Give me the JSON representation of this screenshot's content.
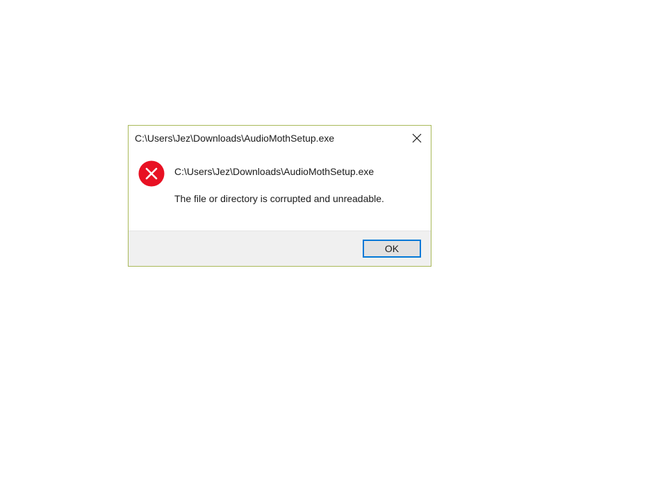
{
  "dialog": {
    "title": "C:\\Users\\Jez\\Downloads\\AudioMothSetup.exe",
    "close_icon": "close-icon",
    "error_icon": "error-icon",
    "message_path": "C:\\Users\\Jez\\Downloads\\AudioMothSetup.exe",
    "message_text": "The file or directory is corrupted and unreadable.",
    "ok_label": "OK"
  },
  "colors": {
    "error_red": "#e81123",
    "button_focus_border": "#0078d7",
    "footer_bg": "#f0f0f0",
    "window_border": "#a8b858"
  }
}
